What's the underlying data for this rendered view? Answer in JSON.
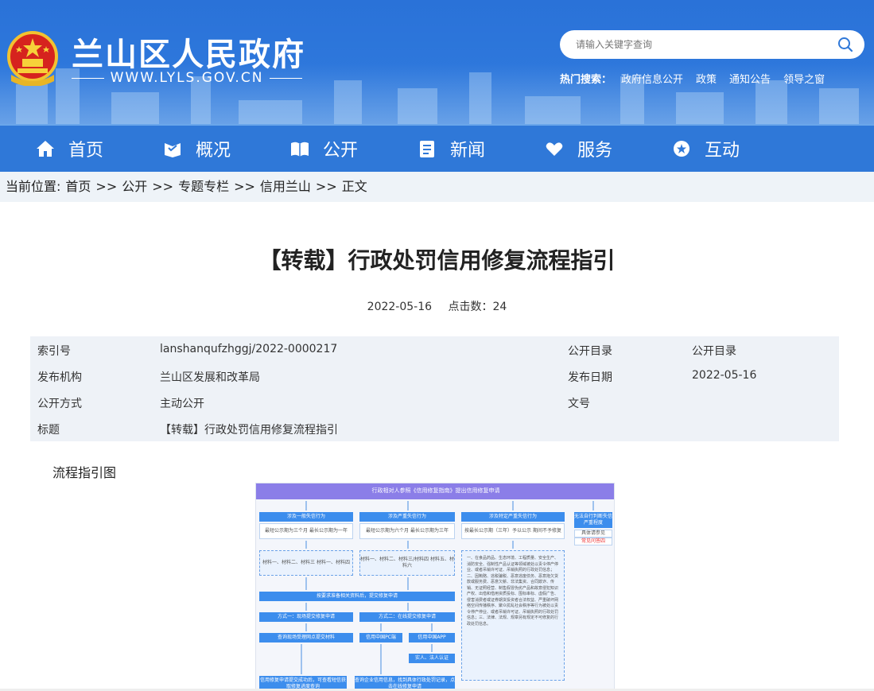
{
  "header": {
    "site_title": "兰山区人民政府",
    "site_url": "WWW.LYLS.GOV.CN",
    "search_placeholder": "请输入关键字查询",
    "hot_label": "热门搜索：",
    "hot_links": [
      "政府信息公开",
      "政策",
      "通知公告",
      "领导之窗"
    ]
  },
  "nav": {
    "items": [
      {
        "label": "首页",
        "icon": "home-icon"
      },
      {
        "label": "概况",
        "icon": "overview-icon"
      },
      {
        "label": "公开",
        "icon": "book-icon"
      },
      {
        "label": "新闻",
        "icon": "news-icon"
      },
      {
        "label": "服务",
        "icon": "heart-hand-icon"
      },
      {
        "label": "互动",
        "icon": "chat-icon"
      }
    ]
  },
  "breadcrumb": {
    "prefix": "当前位置:",
    "items": [
      "首页",
      "公开",
      "专题专栏",
      "信用兰山",
      "正文"
    ],
    "separator": ">>"
  },
  "article": {
    "title": "【转载】行政处罚信用修复流程指引",
    "date": "2022-05-16",
    "views_label": "点击数：",
    "views": "24",
    "info": {
      "index_label": "索引号",
      "index_value": "lanshanqufzhggj/2022-0000217",
      "catalog_label": "公开目录",
      "catalog_value": "公开目录",
      "org_label": "发布机构",
      "org_value": "兰山区发展和改革局",
      "pubdate_label": "发布日期",
      "pubdate_value": "2022-05-16",
      "method_label": "公开方式",
      "method_value": "主动公开",
      "docno_label": "文号",
      "docno_value": "",
      "subject_label": "标题",
      "subject_value": "【转载】行政处罚信用修复流程指引"
    },
    "figure_label": "流程指引图"
  },
  "flowchart": {
    "top": "行政相对人参照《信用修复指南》提出信用修复申请",
    "col1_head": "涉及一般失信行为",
    "col1_sub": "最短公示期为三个月 最长公示期为一年",
    "col1_mat": "材料一、材料二、材料三 材料一、材料四",
    "col2_head": "涉及严重失信行为",
    "col2_sub": "最短公示期为六个月 最长公示期为三年",
    "col2_mat": "材料一、材料二、材料三/材料四 材料五、材料六",
    "col3_head": "涉及特定严重失信行为",
    "col3_sub": "按最长公示期（三年）予以公示 期间不予修复",
    "col4_head": "无法自行判断失信严重程度",
    "col4_sub": "具体请参见",
    "col4_link": "常见问答四",
    "submit": "按要求准备相关资料后，提交修复申请",
    "way1": "方式一：现场提交修复申请",
    "way2": "方式二：在线提交修复申请",
    "way1_step": "查询现场受理网点提交材料",
    "way2_pc": "信用中国PC端",
    "way2_app": "信用中国APP",
    "realname": "实人、法人认证",
    "final1": "信用修复申请提交成功后，可查看短信获取修复进度查询",
    "final2": "查询企业信用信息，找到具体行政处罚记录，点击在线修复申请",
    "notes": "一、在食品药品、生态环境、工程质量、安全生产、消防安全、强制性产品认证等领域被处以责令停产停业、或者吊销许可证、吊销执照的行政处罚信息；二、因贿赂、逃税骗税、恶意逃废债务、恶意拖欠货款或服务费、恶意欠薪、非法集资、合同欺诈、传销、无证照经营、制售假冒伪劣产品和故意侵犯知识产权、出借和借用资质投标、围标串标、虚假广告、侵害消费者或证券期货投资者合法权益、严重破坏网络空间传播秩序、聚众扰乱社会秩序等行为被处以责令停产停业、或者吊销许可证、吊销执照的行政处罚信息；三、法律、法规、规章另有规定不可修复的行政处罚信息。"
  }
}
